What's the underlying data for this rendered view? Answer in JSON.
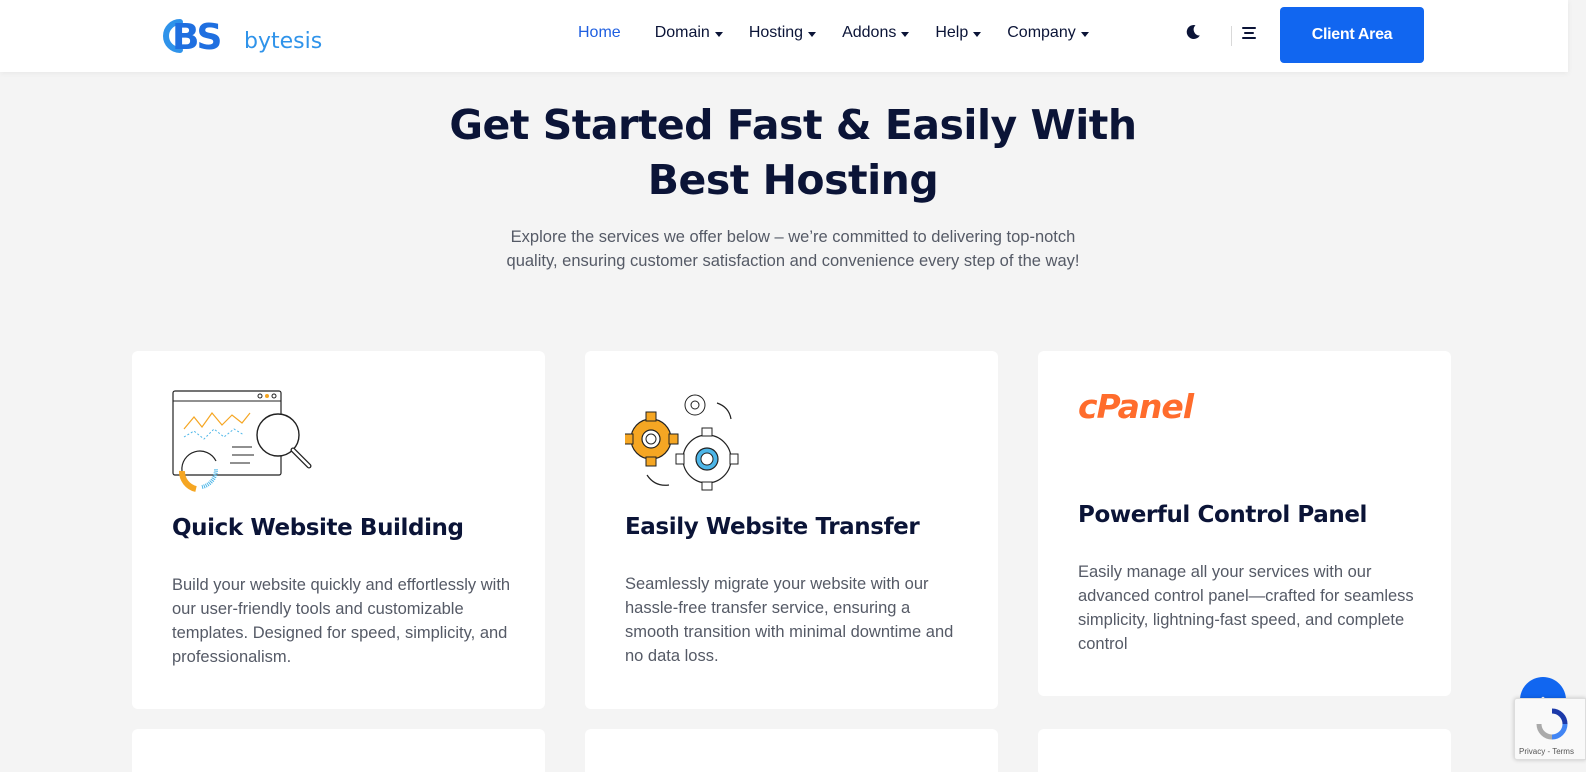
{
  "header": {
    "logo_mark": "BS",
    "logo_text": "bytesis",
    "nav": [
      {
        "label": "Home",
        "dropdown": false,
        "active": true
      },
      {
        "label": "Domain",
        "dropdown": true
      },
      {
        "label": "Hosting",
        "dropdown": true
      },
      {
        "label": "Addons",
        "dropdown": true
      },
      {
        "label": "Help",
        "dropdown": true
      },
      {
        "label": "Company",
        "dropdown": true
      }
    ],
    "theme_toggle_icon": "moon-icon",
    "menu_icon": "hamburger-menu-icon",
    "client_button": "Client Area"
  },
  "hero": {
    "title_line1": "Get Started Fast & Easily With",
    "title_line2": "Best Hosting",
    "subtitle": "Explore the services we offer below – we’re committed to delivering top-notch quality, ensuring customer satisfaction and convenience every step of the way!"
  },
  "cards": [
    {
      "icon": "website-analytics-icon",
      "title": "Quick Website Building",
      "description": "Build your website quickly and effortlessly with our user-friendly tools and customizable templates. Designed for speed, simplicity, and professionalism."
    },
    {
      "icon": "gears-transfer-icon",
      "title": "Easily Website Transfer",
      "description": "Seamlessly migrate your website with our hassle-free transfer service, ensuring a smooth transition with minimal downtime and no data loss."
    },
    {
      "icon": "cpanel-logo",
      "logo_text": "cPanel",
      "title": "Powerful Control Panel",
      "description": "Easily manage all your services with our advanced control panel—crafted for seamless simplicity, lightning-fast speed, and complete control"
    }
  ],
  "widgets": {
    "scroll_top_icon": "chevron-up-icon",
    "recaptcha_text": "Privacy - Terms"
  },
  "colors": {
    "accent": "#1166f0",
    "heading": "#0b1437",
    "body_text": "#555a66",
    "cpanel_orange": "#ff6c2c",
    "background": "#f4f4f4"
  }
}
